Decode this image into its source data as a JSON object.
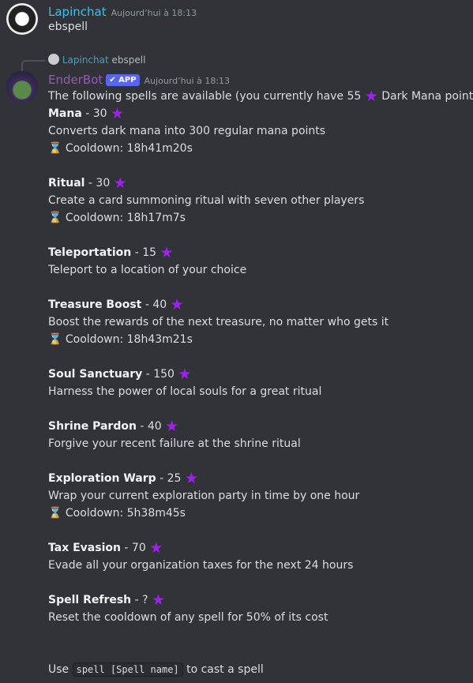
{
  "user_msg": {
    "author": "Lapinchat",
    "timestamp": "Aujourd’hui à 18:13",
    "text": "ebspell",
    "name_color": "#3fc1e7"
  },
  "bot_msg": {
    "reply": {
      "author": "Lapinchat",
      "text": "ebspell"
    },
    "author": "EnderBot",
    "badge": "✔ APP",
    "timestamp": "Aujourd’hui à 18:13",
    "name_color": "#9b59b6",
    "intro_before": "The following spells are available (you currently have 55",
    "intro_after": "Dark Mana points):",
    "spells": [
      {
        "name": "Mana",
        "cost": " - 30",
        "desc": "Converts dark mana into 300 regular mana points",
        "cooldown": "Cooldown: 18h41m20s"
      },
      {
        "name": "Ritual",
        "cost": " - 30",
        "desc": "Create a card summoning ritual with seven other players",
        "cooldown": "Cooldown: 18h17m7s"
      },
      {
        "name": "Teleportation",
        "cost": " - 15",
        "desc": "Teleport to a location of your choice"
      },
      {
        "name": "Treasure Boost",
        "cost": " - 40",
        "desc": "Boost the rewards of the next treasure, no matter who gets it",
        "cooldown": "Cooldown: 18h43m21s"
      },
      {
        "name": "Soul Sanctuary",
        "cost": " - 150",
        "desc": "Harness the power of local souls for a great ritual"
      },
      {
        "name": "Shrine Pardon",
        "cost": " - 40",
        "desc": "Forgive your recent failure at the shrine ritual"
      },
      {
        "name": "Exploration Warp",
        "cost": " - 25",
        "desc": "Wrap your current exploration party in time by one hour",
        "cooldown": "Cooldown: 5h38m45s"
      },
      {
        "name": "Tax Evasion",
        "cost": " - 70",
        "desc": "Evade all your organization taxes for the next 24 hours"
      },
      {
        "name": "Spell Refresh",
        "cost": " - ?",
        "desc": "Reset the cooldown of any spell for 50% of its cost"
      }
    ],
    "footer_before": "Use",
    "footer_code": "spell [Spell name]",
    "footer_after": "to cast a spell"
  },
  "icons": {
    "star": "purple-star-icon",
    "cooldown": "hourglass-icon"
  }
}
